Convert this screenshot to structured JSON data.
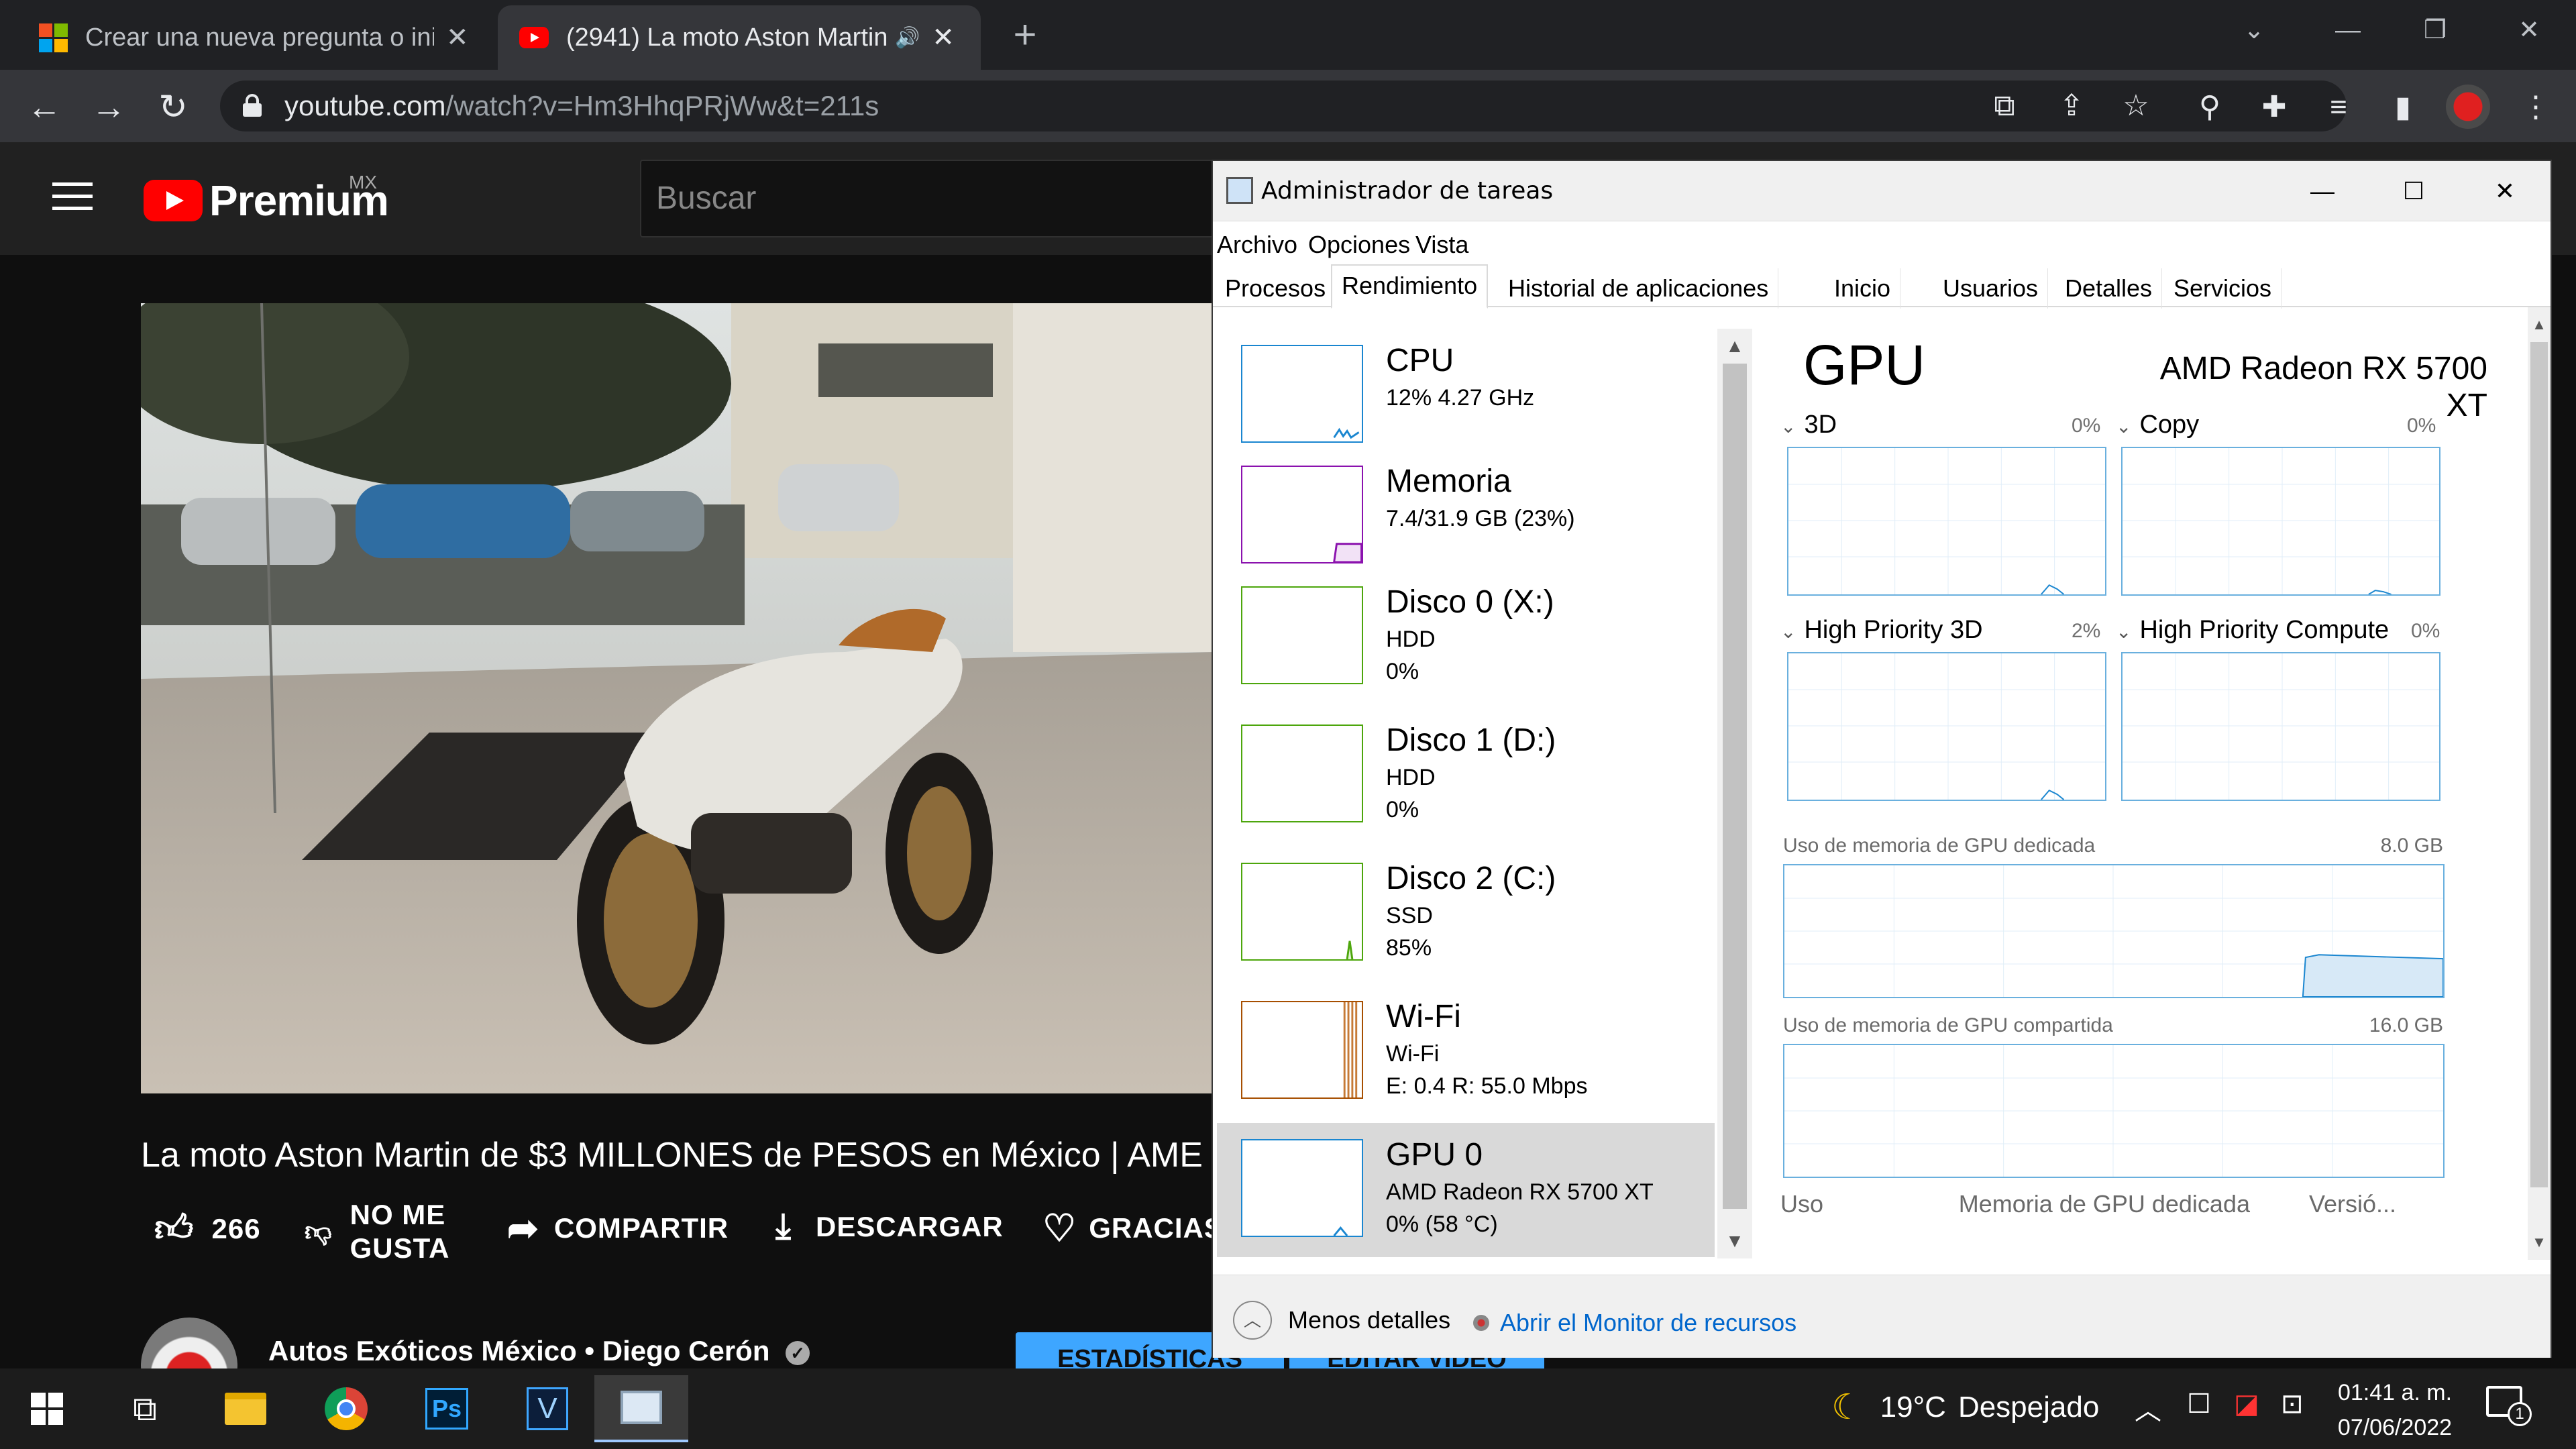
{
  "browser": {
    "tabs": [
      {
        "title": "Crear una nueva pregunta o inicia",
        "favicon": "windows-logo-icon",
        "close": "✕"
      },
      {
        "title": "(2941) La moto Aston Martin",
        "favicon": "youtube-icon",
        "close": "✕",
        "audio": "🔊"
      }
    ],
    "url_host": "youtube.com",
    "url_path": "/watch?v=Hm3HhqPRjWw&t=211s"
  },
  "youtube": {
    "logo_text": "Premium",
    "logo_region": "MX",
    "search_placeholder": "Buscar",
    "video_title": "La moto Aston Martin de $3 MILLONES de PESOS en México | AME",
    "actions": {
      "like_count": "266",
      "dislike_line1": "NO ME",
      "dislike_line2": "GUSTA",
      "share": "COMPARTIR",
      "download": "DESCARGAR",
      "thanks": "GRACIAS"
    },
    "channel_name": "Autos Exóticos México • Diego Cerón",
    "stats_button": "ESTADÍSTICAS",
    "edit_button": "EDITAR VIDEO"
  },
  "task_manager": {
    "title": "Administrador de tareas",
    "menu": [
      "Archivo",
      "Opciones",
      "Vista"
    ],
    "tabs": [
      "Procesos",
      "Rendimiento",
      "Historial de aplicaciones",
      "Inicio",
      "Usuarios",
      "Detalles",
      "Servicios"
    ],
    "active_tab": "Rendimiento",
    "sidebar": [
      {
        "name": "CPU",
        "line1": "12%  4.27 GHz",
        "line2": "",
        "color": "#1a86d0"
      },
      {
        "name": "Memoria",
        "line1": "7.4/31.9 GB (23%)",
        "line2": "",
        "color": "#8b12ae"
      },
      {
        "name": "Disco 0 (X:)",
        "line1": "HDD",
        "line2": "0%",
        "color": "#4da60c"
      },
      {
        "name": "Disco 1 (D:)",
        "line1": "HDD",
        "line2": "0%",
        "color": "#4da60c"
      },
      {
        "name": "Disco 2 (C:)",
        "line1": "SSD",
        "line2": "85%",
        "color": "#4da60c"
      },
      {
        "name": "Wi-Fi",
        "line1": "Wi-Fi",
        "line2": "E: 0.4  R: 55.0 Mbps",
        "color": "#a74f01"
      },
      {
        "name": "GPU 0",
        "line1": "AMD Radeon RX 5700 XT",
        "line2": "0% (58 °C)",
        "color": "#1a86d0"
      }
    ],
    "gpu": {
      "heading": "GPU",
      "model": "AMD Radeon RX 5700 XT",
      "engines": [
        {
          "label": "3D",
          "percent": "0%"
        },
        {
          "label": "Copy",
          "percent": "0%"
        },
        {
          "label": "High Priority 3D",
          "percent": "2%"
        },
        {
          "label": "High Priority Compute",
          "percent": "0%"
        }
      ],
      "dedicated_label": "Uso de memoria de GPU dedicada",
      "dedicated_max": "8.0 GB",
      "shared_label": "Uso de memoria de GPU compartida",
      "shared_max": "16.0 GB",
      "bottom_labels": [
        "Uso",
        "Memoria de GPU dedicada",
        "Versió..."
      ]
    },
    "footer": {
      "less_details": "Menos detalles",
      "open_monitor": "Abrir el Monitor de recursos"
    }
  },
  "taskbar": {
    "apps": [
      "windows-start-icon",
      "task-view-icon",
      "file-explorer-icon",
      "chrome-icon",
      "photoshop-icon",
      "vegas-icon",
      "task-manager-icon"
    ],
    "weather_temp": "19°C",
    "weather_desc": "Despejado",
    "time": "01:41 a. m.",
    "date": "07/06/2022",
    "notification_count": "1"
  }
}
